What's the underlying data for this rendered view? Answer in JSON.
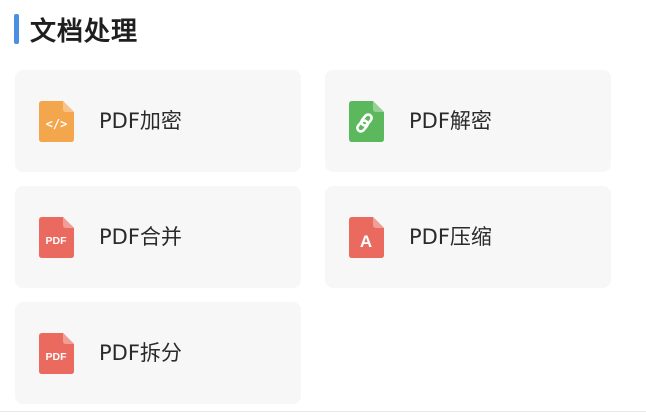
{
  "section": {
    "title": "文档处理",
    "accent_color": "#4a90e2"
  },
  "tools": [
    {
      "label": "PDF加密",
      "icon": "code-file-icon",
      "icon_color": "#f3a64b",
      "icon_glyph": "</>"
    },
    {
      "label": "PDF解密",
      "icon": "link-file-icon",
      "icon_color": "#5cb85c",
      "icon_glyph": ""
    },
    {
      "label": "PDF合并",
      "icon": "pdf-file-icon",
      "icon_color": "#ea6a5f",
      "icon_glyph": "PDF"
    },
    {
      "label": "PDF压缩",
      "icon": "a-file-icon",
      "icon_color": "#ea6a5f",
      "icon_glyph": "A"
    },
    {
      "label": "PDF拆分",
      "icon": "pdf-file-icon",
      "icon_color": "#ea6a5f",
      "icon_glyph": "PDF"
    }
  ]
}
